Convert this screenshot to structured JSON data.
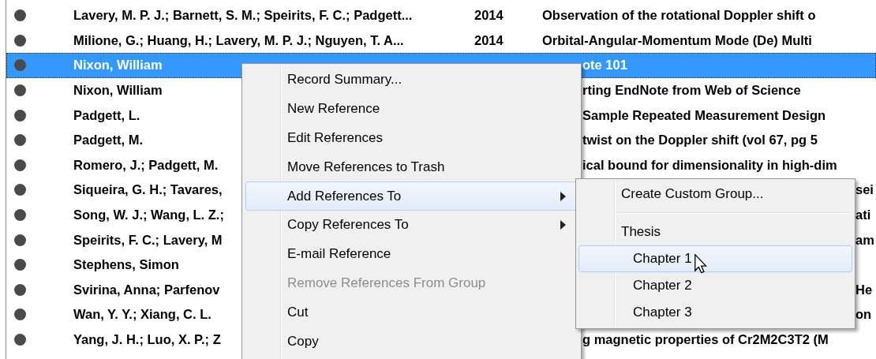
{
  "references": [
    {
      "author": "Lavery, M. P. J.; Barnett, S. M.; Speirits, F. C.; Padgett...",
      "year": "2014",
      "title": "Observation of the rotational Doppler shift o",
      "selected": false
    },
    {
      "author": "Milione, G.; Huang, H.; Lavery, M. P. J.; Nguyen, T. A...",
      "year": "2014",
      "title": "Orbital-Angular-Momentum Mode (De) Multi",
      "selected": false
    },
    {
      "author": "Nixon, William",
      "title": "ote 101",
      "selected": true
    },
    {
      "author": "Nixon, William",
      "title": "rting EndNote from Web of Science",
      "selected": false
    },
    {
      "author": "Padgett, L.",
      "title": "Sample Repeated Measurement Design",
      "selected": false
    },
    {
      "author": "Padgett, M.",
      "title": "twist on the Doppler shift (vol 67, pg 5",
      "selected": false
    },
    {
      "author": "Romero, J.; Padgett, M.",
      "title": "ical bound for dimensionality in high-dim",
      "selected": false
    },
    {
      "author": "Siqueira, G. H.; Tavares,",
      "title": "sei",
      "selected": false
    },
    {
      "author": "Song, W. J.; Wang, L. Z.;",
      "title": "ati",
      "selected": false
    },
    {
      "author": "Speirits, F. C.; Lavery, M",
      "title": "am",
      "selected": false
    },
    {
      "author": "Stephens, Simon",
      "selected": false
    },
    {
      "author": "Svirina, Anna; Parfenov",
      "title": "He",
      "selected": false
    },
    {
      "author": "Wan, Y. Y.; Xiang, C. L.",
      "title": "on",
      "selected": false
    },
    {
      "author": "Yang, J. H.; Luo, X. P.; Z",
      "title": "g magnetic properties of Cr2M2C3T2 (M",
      "selected": false
    }
  ],
  "context_menu": {
    "items": [
      {
        "label": "Record Summary...",
        "kind": "action",
        "disabled": false,
        "selected": false
      },
      {
        "label": "New Reference",
        "kind": "action",
        "disabled": false,
        "selected": false
      },
      {
        "label": "Edit References",
        "kind": "action",
        "disabled": false,
        "selected": false
      },
      {
        "label": "Move References to Trash",
        "kind": "action",
        "disabled": false,
        "selected": false
      },
      {
        "label": "Add References To",
        "kind": "submenu",
        "disabled": false,
        "selected": true
      },
      {
        "label": "Copy References To",
        "kind": "submenu",
        "disabled": false,
        "selected": false
      },
      {
        "label": "E-mail Reference",
        "kind": "action",
        "disabled": false,
        "selected": false
      },
      {
        "label": "Remove References From Group",
        "kind": "action",
        "disabled": true,
        "selected": false
      },
      {
        "label": "Cut",
        "kind": "action",
        "disabled": false,
        "selected": false
      },
      {
        "label": "Copy",
        "kind": "action",
        "disabled": false,
        "selected": false
      }
    ]
  },
  "submenu": {
    "items": [
      {
        "label": "Create Custom Group...",
        "kind": "action",
        "selected": false
      },
      {
        "kind": "separator"
      },
      {
        "label": "Thesis",
        "kind": "header",
        "selected": false
      },
      {
        "label": "Chapter 1",
        "kind": "group",
        "selected": true
      },
      {
        "label": "Chapter 2",
        "kind": "group",
        "selected": false
      },
      {
        "label": "Chapter 3",
        "kind": "group",
        "selected": false
      }
    ]
  }
}
